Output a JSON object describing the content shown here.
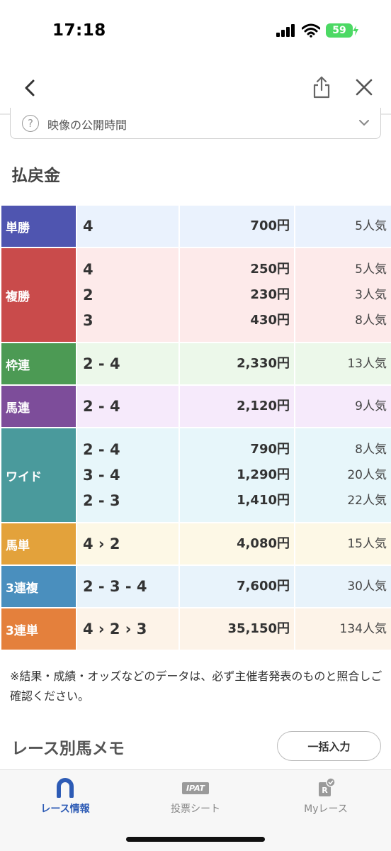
{
  "status": {
    "time": "17:18",
    "battery": "59"
  },
  "video": {
    "label": "映像の公開時間"
  },
  "section_title": "払戻金",
  "payouts": [
    {
      "type": "単勝",
      "color": "#4f55b0",
      "bg": "#eaf2fd",
      "rows": [
        {
          "combo": "4",
          "amount": "700円",
          "pop": "5人気"
        }
      ]
    },
    {
      "type": "複勝",
      "color": "#c94b4b",
      "bg": "#fdeaea",
      "rows": [
        {
          "combo": "4",
          "amount": "250円",
          "pop": "5人気"
        },
        {
          "combo": "2",
          "amount": "230円",
          "pop": "3人気"
        },
        {
          "combo": "3",
          "amount": "430円",
          "pop": "8人気"
        }
      ]
    },
    {
      "type": "枠連",
      "color": "#4c9a54",
      "bg": "#ecf8ea",
      "rows": [
        {
          "combo": "2 - 4",
          "amount": "2,330円",
          "pop": "13人気"
        }
      ]
    },
    {
      "type": "馬連",
      "color": "#7d4d9a",
      "bg": "#f6eafb",
      "rows": [
        {
          "combo": "2 - 4",
          "amount": "2,120円",
          "pop": "9人気"
        }
      ]
    },
    {
      "type": "ワイド",
      "color": "#4a9a9c",
      "bg": "#e7f6fa",
      "rows": [
        {
          "combo": "2 - 4",
          "amount": "790円",
          "pop": "8人気"
        },
        {
          "combo": "3 - 4",
          "amount": "1,290円",
          "pop": "20人気"
        },
        {
          "combo": "2 - 3",
          "amount": "1,410円",
          "pop": "22人気"
        }
      ]
    },
    {
      "type": "馬単",
      "color": "#e3a23b",
      "bg": "#fdf8e6",
      "rows": [
        {
          "combo": "4 › 2",
          "amount": "4,080円",
          "pop": "15人気"
        }
      ]
    },
    {
      "type": "3連複",
      "color": "#4a8fbe",
      "bg": "#e8f3fb",
      "rows": [
        {
          "combo": "2 - 3 - 4",
          "amount": "7,600円",
          "pop": "30人気"
        }
      ]
    },
    {
      "type": "3連単",
      "color": "#e4803c",
      "bg": "#fdf3e8",
      "rows": [
        {
          "combo": "4 › 2 › 3",
          "amount": "35,150円",
          "pop": "134人気"
        }
      ]
    }
  ],
  "note": "※結果・成績・オッズなどのデータは、必ず主催者発表のものと照合しご確認ください。",
  "memo": {
    "title": "レース別馬メモ",
    "bulk_button": "一括入力"
  },
  "tabs": [
    {
      "label": "レース情報",
      "icon": "horseshoe-icon"
    },
    {
      "label": "投票シート",
      "icon": "ipat-icon",
      "icon_text": "IPAT"
    },
    {
      "label": "Myレース",
      "icon": "my-race-icon",
      "icon_text": "R"
    }
  ],
  "colors": {
    "accent": "#2d5bb5",
    "tab_inactive": "#888888"
  }
}
